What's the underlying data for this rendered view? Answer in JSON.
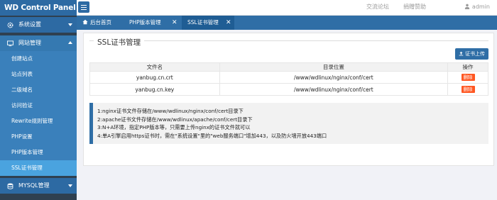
{
  "header": {
    "logo": "WD Control Panel",
    "links": [
      "交流论坛",
      "捐赠赞助"
    ],
    "user": "admin"
  },
  "sidebar": {
    "system": "系统设置",
    "site": "网站管理",
    "items": [
      "创建站点",
      "站点列表",
      "二级域名",
      "访问验证",
      "Rewrite规则管理",
      "PHP设置",
      "PHP版本管理",
      "SSL证书管理"
    ],
    "mysql": "MYSQL管理"
  },
  "tabs": [
    {
      "label": "后台首页"
    },
    {
      "label": "PHP版本管理"
    },
    {
      "label": "SSL证书管理"
    }
  ],
  "main": {
    "title": "SSL证书管理",
    "upload_label": "证书上传",
    "columns": [
      "文件名",
      "目录位置",
      "操作"
    ],
    "rows": [
      {
        "name": "yanbug.cn.crt",
        "path": "/www/wdlinux/nginx/conf/cert",
        "action": "删除"
      },
      {
        "name": "yanbug.cn.key",
        "path": "/www/wdlinux/nginx/conf/cert",
        "action": "删除"
      }
    ],
    "notes": [
      "1:nginx证书文件存储在/www/wdlinux/nginx/conf/cert目录下",
      "2:apache证书文件存储在/www/wdlinux/apache/conf/cert目录下",
      "3:N+A环境，指定PHP版本等，只需要上传nginx的证书文件就可以",
      "4:单A引擎启用https证书时，需在\"系统设置\"里的\"web服务端口\"增加443，以及防火墙开放443端口"
    ]
  },
  "colors": {
    "brand": "#2d6aa3",
    "sidebar_bg": "#2f4050",
    "active_item": "#4aa3df",
    "danger": "#ff5722"
  }
}
